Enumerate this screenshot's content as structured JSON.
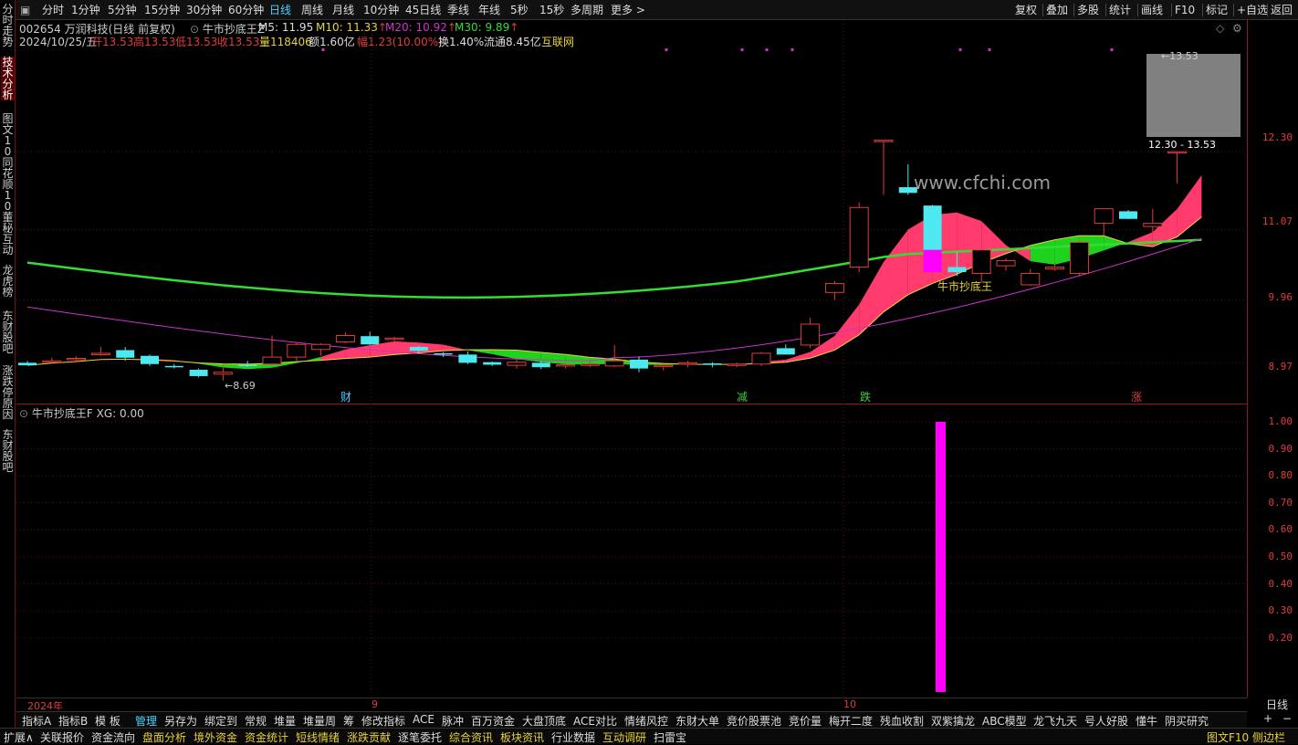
{
  "toolbar": {
    "periods": [
      "分时",
      "1分钟",
      "5分钟",
      "15分钟",
      "30分钟",
      "60分钟",
      "日线",
      "周线",
      "月线",
      "10分钟",
      "45日线",
      "季线",
      "年线",
      "5秒",
      "15秒",
      "多周期",
      "更多 >"
    ],
    "active_period": "日线",
    "right": [
      "复权",
      "叠加",
      "多股",
      "统计",
      "画线",
      "F10",
      "标记",
      "+自选",
      "返回"
    ]
  },
  "left_tabs": [
    "分时走势",
    "技术分析",
    "图文10",
    "同花顺10",
    "董秘互动",
    "龙虎榜",
    "东财股吧",
    "涨跌停原因",
    "东财股吧"
  ],
  "stock": {
    "title": "002654 万润科技(日线 前复权)",
    "indicator": "牛市抄底王Z",
    "m5": "M5: 11.95",
    "m10": "M10: 11.33",
    "m20": "M20: 10.92",
    "m30": "M30: 9.89",
    "date": "2024/10/25/五",
    "open": "开13.53",
    "high": "高13.53",
    "low": "低13.53",
    "close": "收13.53",
    "volume": "量118406",
    "amount": "额1.60亿",
    "change": "幅1.23(10.00%)",
    "turnover": "换1.40%",
    "float": "流通8.45亿",
    "source": "互联网"
  },
  "colors": {
    "up": "#e03c3c",
    "down": "#4de8f0",
    "ma_green": "#33dd33",
    "ma_purple": "#cc33cc",
    "band_pink": "#ff3b6e",
    "band_green": "#1ed21e",
    "xg_bar": "#ff00ff"
  },
  "chart_annotations": {
    "low_marker": "8.69",
    "high_marker": "13.53",
    "range_box": "12.30 - 13.53",
    "signal_label": "牛市抄底王",
    "watermark": "www.cfchi.com",
    "events": [
      "财",
      "减",
      "跌",
      "涨"
    ]
  },
  "price_axis": [
    "12.30",
    "11.07",
    "9.96",
    "8.97"
  ],
  "sub_indicator": {
    "name": "牛市抄底王F",
    "xg": "XG: 0.00",
    "axis": [
      "1.00",
      "0.90",
      "0.80",
      "0.70",
      "0.60",
      "0.50",
      "0.40",
      "0.30",
      "0.20"
    ]
  },
  "x_axis": [
    "2024年",
    "9",
    "10"
  ],
  "period_label": "日线",
  "indicator_tabs": [
    "指标A",
    "指标B",
    "模 板",
    "管理",
    "另存为",
    "绑定到",
    "常规",
    "堆量",
    "堆量周",
    "筹",
    "修改指标",
    "ACE",
    "脉冲",
    "百万资金",
    "大盘顶底",
    "ACE对比",
    "情绪风控",
    "东财大单",
    "竞价股票池",
    "竞价量",
    "梅开二度",
    "残血收割",
    "双紫擒龙",
    "ABC模型",
    "龙飞九天",
    "号人好股",
    "懂牛",
    "阴买研究"
  ],
  "active_indicator_tab": "管理",
  "bottom_tabs": [
    "扩展∧",
    "关联报价",
    "资金流向",
    "盘面分析",
    "境外资金",
    "资金统计",
    "短线情绪",
    "涨跌贡献",
    "逐笔委托",
    "综合资讯",
    "板块资讯",
    "行业数据",
    "互动调研",
    "扫雷宝"
  ],
  "bottom_right": "图文F10 侧边栏",
  "chart_data": {
    "type": "candlestick",
    "y_range": [
      8.5,
      13.8
    ],
    "candles": [
      {
        "o": 8.97,
        "h": 9.0,
        "l": 8.93,
        "c": 8.93
      },
      {
        "o": 9.0,
        "h": 9.05,
        "l": 8.97,
        "c": 9.0
      },
      {
        "o": 9.03,
        "h": 9.07,
        "l": 8.99,
        "c": 9.04
      },
      {
        "o": 9.12,
        "h": 9.22,
        "l": 9.08,
        "c": 9.12
      },
      {
        "o": 9.17,
        "h": 9.22,
        "l": 9.0,
        "c": 9.05
      },
      {
        "o": 9.08,
        "h": 9.1,
        "l": 8.92,
        "c": 8.95
      },
      {
        "o": 8.92,
        "h": 8.95,
        "l": 8.88,
        "c": 8.9
      },
      {
        "o": 8.86,
        "h": 8.88,
        "l": 8.74,
        "c": 8.76
      },
      {
        "o": 8.79,
        "h": 8.92,
        "l": 8.69,
        "c": 8.82
      },
      {
        "o": 8.94,
        "h": 9.0,
        "l": 8.9,
        "c": 8.92
      },
      {
        "o": 8.95,
        "h": 9.4,
        "l": 8.92,
        "c": 9.06
      },
      {
        "o": 9.06,
        "h": 9.3,
        "l": 9.0,
        "c": 9.26
      },
      {
        "o": 9.18,
        "h": 9.28,
        "l": 9.08,
        "c": 9.26
      },
      {
        "o": 9.3,
        "h": 9.45,
        "l": 9.28,
        "c": 9.4
      },
      {
        "o": 9.39,
        "h": 9.46,
        "l": 9.25,
        "c": 9.26
      },
      {
        "o": 9.34,
        "h": 9.38,
        "l": 9.28,
        "c": 9.36
      },
      {
        "o": 9.22,
        "h": 9.24,
        "l": 9.12,
        "c": 9.16
      },
      {
        "o": 9.12,
        "h": 9.14,
        "l": 9.06,
        "c": 9.1
      },
      {
        "o": 9.1,
        "h": 9.15,
        "l": 8.95,
        "c": 8.97
      },
      {
        "o": 8.98,
        "h": 8.99,
        "l": 8.92,
        "c": 8.94
      },
      {
        "o": 8.93,
        "h": 9.02,
        "l": 8.88,
        "c": 8.98
      },
      {
        "o": 8.97,
        "h": 9.0,
        "l": 8.87,
        "c": 8.9
      },
      {
        "o": 8.92,
        "h": 8.97,
        "l": 8.88,
        "c": 8.94
      },
      {
        "o": 8.94,
        "h": 9.0,
        "l": 8.9,
        "c": 8.95
      },
      {
        "o": 8.92,
        "h": 9.25,
        "l": 8.9,
        "c": 9.0
      },
      {
        "o": 9.02,
        "h": 9.07,
        "l": 8.82,
        "c": 8.88
      },
      {
        "o": 8.92,
        "h": 8.95,
        "l": 8.85,
        "c": 8.93
      },
      {
        "o": 8.95,
        "h": 9.0,
        "l": 8.9,
        "c": 8.97
      },
      {
        "o": 8.96,
        "h": 8.98,
        "l": 8.9,
        "c": 8.95
      },
      {
        "o": 8.94,
        "h": 8.97,
        "l": 8.9,
        "c": 8.95
      },
      {
        "o": 8.95,
        "h": 9.14,
        "l": 8.92,
        "c": 9.12
      },
      {
        "o": 9.2,
        "h": 9.26,
        "l": 9.1,
        "c": 9.1
      },
      {
        "o": 9.25,
        "h": 9.68,
        "l": 9.2,
        "c": 9.58
      },
      {
        "o": 10.08,
        "h": 10.26,
        "l": 9.96,
        "c": 10.22
      },
      {
        "o": 10.48,
        "h": 11.5,
        "l": 10.4,
        "c": 11.42
      },
      {
        "o": 12.48,
        "h": 12.48,
        "l": 11.62,
        "c": 12.48
      },
      {
        "o": 11.74,
        "h": 12.1,
        "l": 11.62,
        "c": 11.65
      },
      {
        "o": 11.45,
        "h": 11.46,
        "l": 10.64,
        "c": 10.75
      },
      {
        "o": 10.48,
        "h": 10.72,
        "l": 10.34,
        "c": 10.4
      },
      {
        "o": 10.38,
        "h": 10.75,
        "l": 10.24,
        "c": 10.75
      },
      {
        "o": 10.5,
        "h": 10.62,
        "l": 10.42,
        "c": 10.58
      },
      {
        "o": 10.2,
        "h": 10.45,
        "l": 10.18,
        "c": 10.38
      },
      {
        "o": 10.45,
        "h": 10.55,
        "l": 10.42,
        "c": 10.48
      },
      {
        "o": 10.38,
        "h": 10.9,
        "l": 10.35,
        "c": 10.87
      },
      {
        "o": 11.17,
        "h": 11.38,
        "l": 10.98,
        "c": 11.4
      },
      {
        "o": 11.36,
        "h": 11.38,
        "l": 11.24,
        "c": 11.24
      },
      {
        "o": 11.12,
        "h": 11.4,
        "l": 11.0,
        "c": 11.17
      },
      {
        "o": 12.3,
        "h": 12.3,
        "l": 11.8,
        "c": 12.3
      },
      {
        "o": 13.53,
        "h": 13.53,
        "l": 13.53,
        "c": 13.53
      }
    ]
  }
}
